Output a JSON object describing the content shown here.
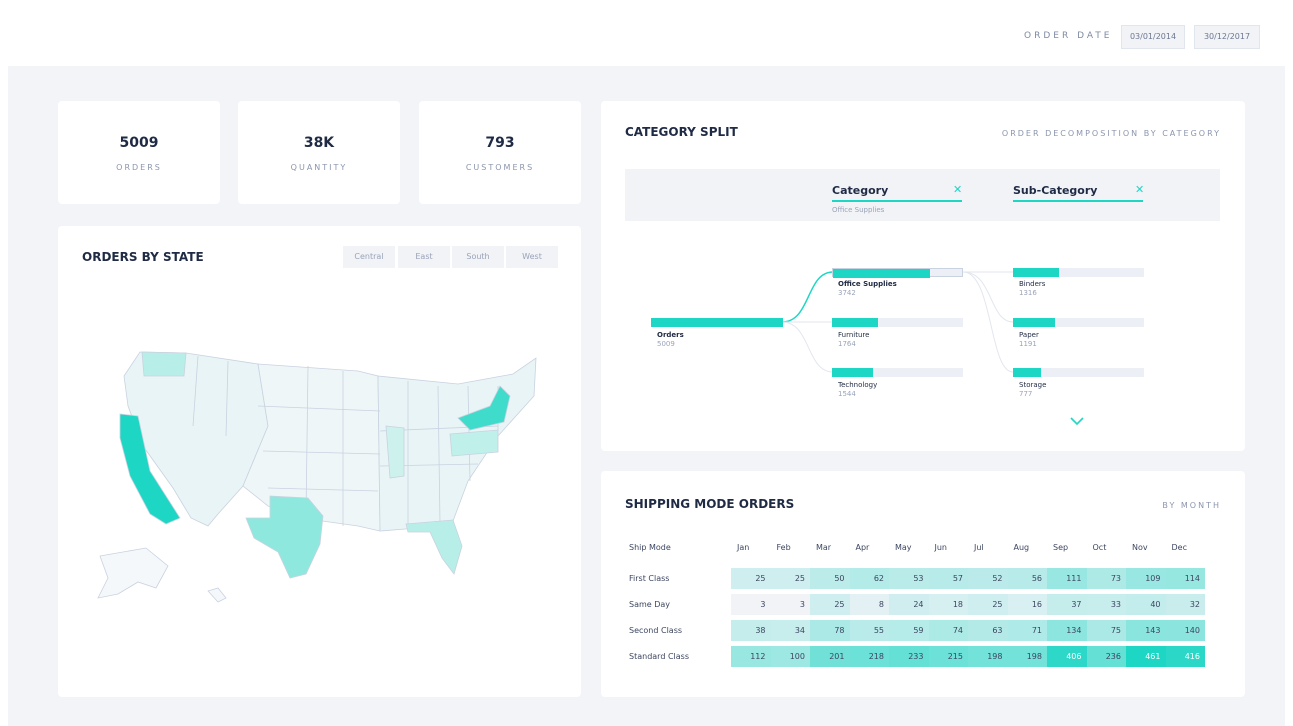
{
  "filters": {
    "label": "ORDER DATE",
    "start_date": "03/01/2014",
    "end_date": "30/12/2017"
  },
  "kpis": [
    {
      "value": "5009",
      "label": "ORDERS"
    },
    {
      "value": "38K",
      "label": "QUANTITY"
    },
    {
      "value": "793",
      "label": "CUSTOMERS"
    }
  ],
  "map_card": {
    "title": "ORDERS BY STATE",
    "regions": [
      "Central",
      "East",
      "South",
      "West"
    ],
    "colors": {
      "low": "#e8f4f6",
      "mid": "#8fe8de",
      "high": "#1ed6c4",
      "border": "#c9d2e0"
    },
    "states_highlighted": [
      "California",
      "Texas",
      "New York",
      "Washington",
      "Pennsylvania",
      "Florida"
    ]
  },
  "category_card": {
    "title": "CATEGORY SPLIT",
    "subtitle": "ORDER DECOMPOSITION BY CATEGORY",
    "levels": [
      {
        "name": "Category",
        "selected": "Office Supplies"
      },
      {
        "name": "Sub-Category",
        "selected": ""
      }
    ],
    "root": {
      "name": "Orders",
      "value": "5009",
      "fraction": 1.0
    },
    "categories": [
      {
        "name": "Office Supplies",
        "value": "3742",
        "fraction": 0.75
      },
      {
        "name": "Furniture",
        "value": "1764",
        "fraction": 0.35
      },
      {
        "name": "Technology",
        "value": "1544",
        "fraction": 0.31
      }
    ],
    "subcategories": [
      {
        "name": "Binders",
        "value": "1316",
        "fraction": 0.35
      },
      {
        "name": "Paper",
        "value": "1191",
        "fraction": 0.32
      },
      {
        "name": "Storage",
        "value": "777",
        "fraction": 0.21
      }
    ],
    "accent_color": "#1ed6c4"
  },
  "shipping_card": {
    "title": "SHIPPING MODE ORDERS",
    "subtitle": "BY MONTH",
    "row_header": "Ship Mode",
    "months": [
      "Jan",
      "Feb",
      "Mar",
      "Apr",
      "May",
      "Jun",
      "Jul",
      "Aug",
      "Sep",
      "Oct",
      "Nov",
      "Dec"
    ],
    "rows": [
      {
        "mode": "First Class",
        "values": [
          "25",
          "25",
          "50",
          "62",
          "53",
          "57",
          "52",
          "56",
          "111",
          "73",
          "109",
          "114"
        ]
      },
      {
        "mode": "Same Day",
        "values": [
          "3",
          "3",
          "25",
          "8",
          "24",
          "18",
          "25",
          "16",
          "37",
          "33",
          "40",
          "32"
        ]
      },
      {
        "mode": "Second Class",
        "values": [
          "38",
          "34",
          "78",
          "55",
          "59",
          "74",
          "63",
          "71",
          "134",
          "75",
          "143",
          "140"
        ]
      },
      {
        "mode": "Standard Class",
        "values": [
          "112",
          "100",
          "201",
          "218",
          "233",
          "215",
          "198",
          "198",
          "406",
          "236",
          "461",
          "416"
        ]
      }
    ],
    "color_scale": {
      "min": "#f1f3f7",
      "max": "#1ed6c4"
    }
  }
}
